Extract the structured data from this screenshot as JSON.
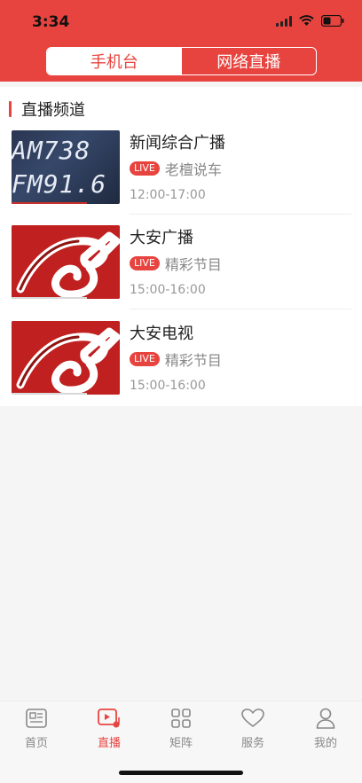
{
  "status": {
    "time": "3:34"
  },
  "segmented": {
    "tabs": [
      {
        "label": "手机台",
        "active": true
      },
      {
        "label": "网络直播",
        "active": false
      }
    ]
  },
  "section": {
    "title": "直播频道"
  },
  "channels": [
    {
      "title": "新闻综合广播",
      "badge": "LIVE",
      "program": "老檀说车",
      "time": "12:00-17:00",
      "thumb_lines": [
        "AM738",
        "FM91.6"
      ]
    },
    {
      "title": "大安广播",
      "badge": "LIVE",
      "program": "精彩节目",
      "time": "15:00-16:00"
    },
    {
      "title": "大安电视",
      "badge": "LIVE",
      "program": "精彩节目",
      "time": "15:00-16:00"
    }
  ],
  "tabbar": {
    "items": [
      {
        "label": "首页",
        "icon": "news-icon",
        "active": false
      },
      {
        "label": "直播",
        "icon": "live-play-icon",
        "active": true
      },
      {
        "label": "矩阵",
        "icon": "grid-icon",
        "active": false
      },
      {
        "label": "服务",
        "icon": "heart-icon",
        "active": false
      },
      {
        "label": "我的",
        "icon": "user-icon",
        "active": false
      }
    ]
  },
  "colors": {
    "accent": "#e8443f",
    "inactive": "#888888"
  }
}
